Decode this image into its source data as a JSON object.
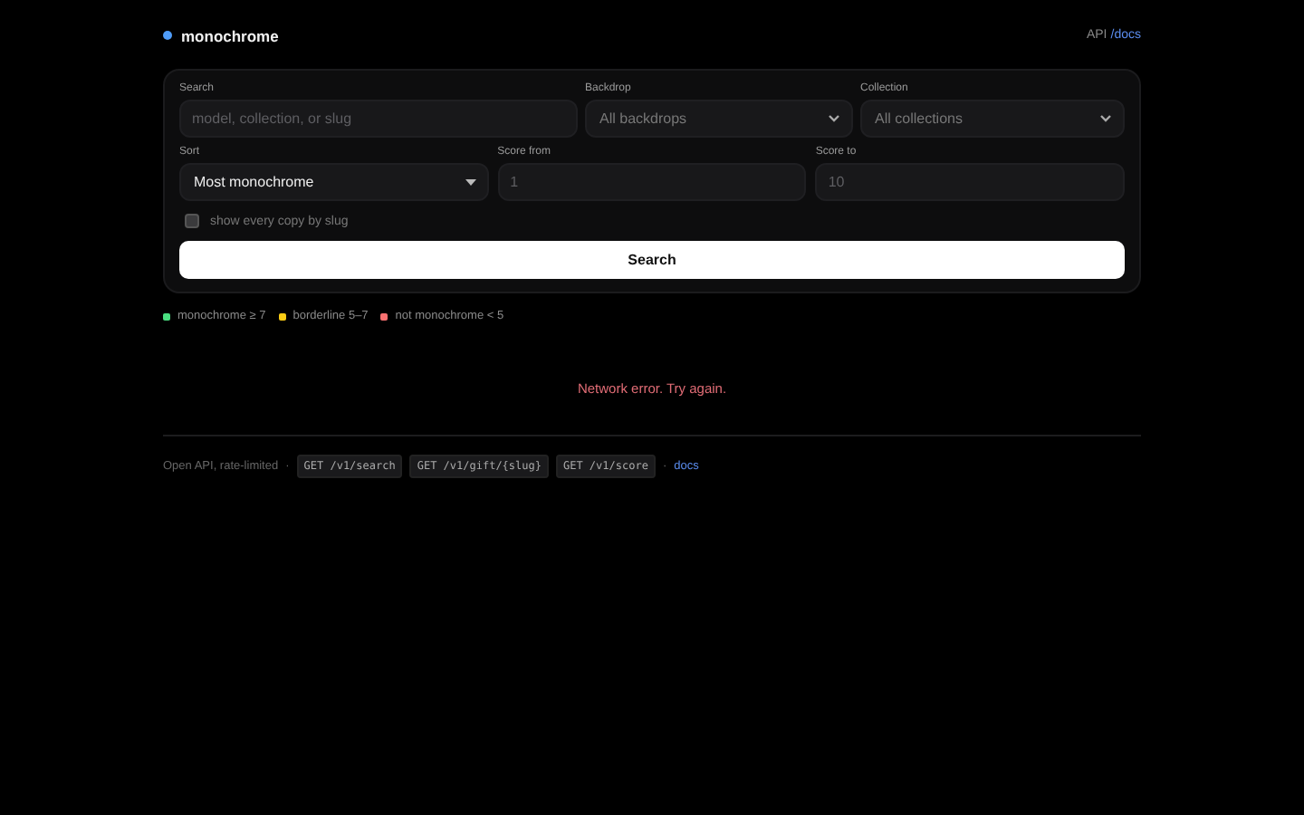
{
  "header": {
    "brand": "monochrome",
    "api_label": "API",
    "docs_link": "/docs"
  },
  "filters": {
    "row_1": [
      {
        "kind": "text",
        "label": "Search",
        "placeholder": "model, collection, or slug"
      },
      {
        "kind": "select",
        "label": "Backdrop",
        "value": "All backdrops"
      },
      {
        "kind": "select",
        "label": "Collection",
        "value": "All collections"
      }
    ],
    "row_2": [
      {
        "kind": "select",
        "label": "Sort",
        "value": "Most monochrome"
      },
      {
        "kind": "text",
        "label": "Score from",
        "placeholder": "1"
      },
      {
        "kind": "text",
        "label": "Score to",
        "placeholder": "10"
      }
    ],
    "checkbox": {
      "label": "show every copy by slug",
      "checked": false
    },
    "button": "Search"
  },
  "legend": [
    {
      "label": "monochrome ≥ 7",
      "color": "#4ade80"
    },
    {
      "label": "borderline 5–7",
      "color": "#facc15"
    },
    {
      "label": "not monochrome < 5",
      "color": "#f87171"
    }
  ],
  "error": "Network error. Try again.",
  "footer": {
    "text": "Open API, rate-limited",
    "separator": "·",
    "endpoints": [
      "GET /v1/search",
      "GET /v1/gift/{slug}",
      "GET /v1/score"
    ],
    "separator_2": "·",
    "docs_link": "docs"
  }
}
